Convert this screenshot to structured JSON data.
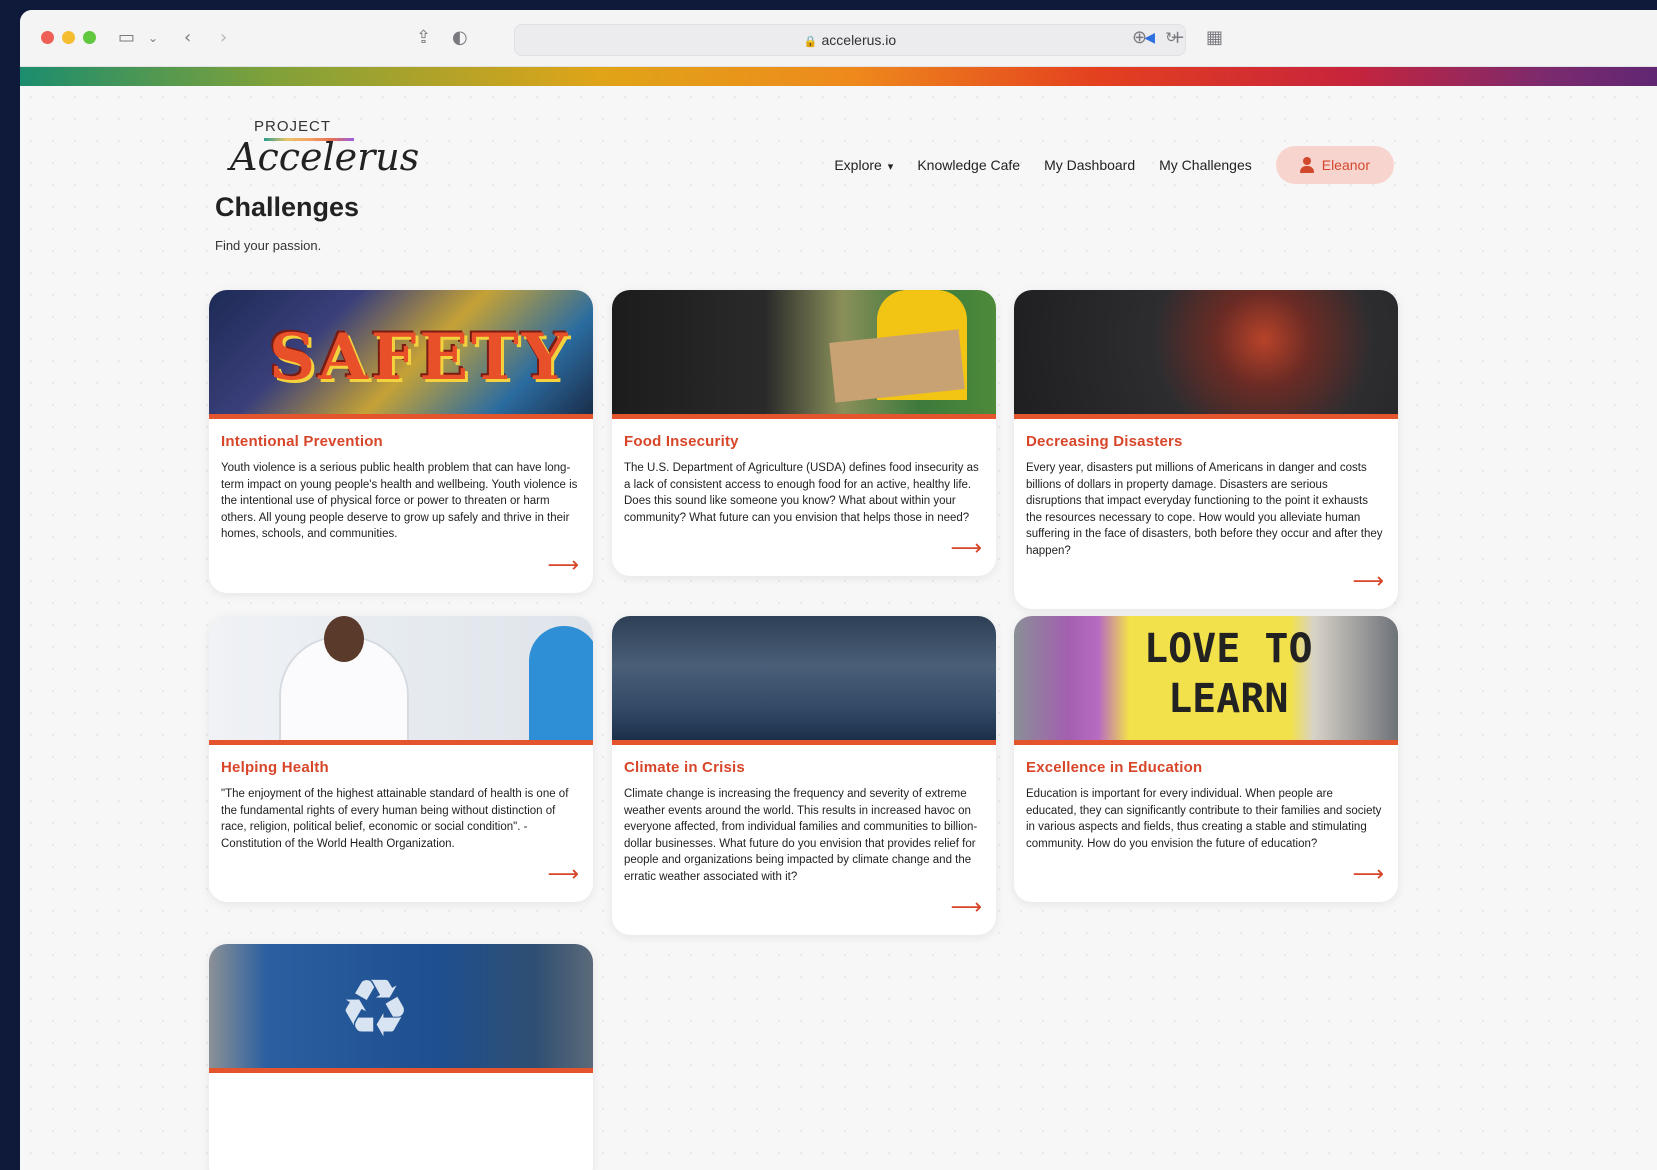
{
  "browser": {
    "url": "accelerus.io"
  },
  "brand": {
    "top": "PROJECT",
    "name": "Accelerus"
  },
  "nav": {
    "items": [
      {
        "label": "Explore"
      },
      {
        "label": "Knowledge Cafe"
      },
      {
        "label": "My Dashboard"
      },
      {
        "label": "My Challenges"
      }
    ],
    "user": "Eleanor"
  },
  "page": {
    "title": "Challenges",
    "subtitle": "Find your passion."
  },
  "cards": [
    {
      "title": "Intentional Prevention",
      "text": "Youth violence is a serious public health problem that can have long-term impact on young people's health and wellbeing. Youth violence is the intentional use of physical force or power to threaten or harm others. All young people deserve to grow up safely and thrive in their homes, schools, and communities.",
      "image_word": "SAFETY"
    },
    {
      "title": "Food Insecurity",
      "text": "The U.S. Department of Agriculture (USDA) defines food insecurity as a lack of consistent access to enough food for an active, healthy life. Does this sound like someone you know? What about within your community? What future can you envision that helps those in need?"
    },
    {
      "title": "Decreasing Disasters",
      "text": "Every year, disasters put millions of Americans in danger and costs billions of dollars in property damage. Disasters are serious disruptions that impact everyday functioning to the point it exhausts the resources necessary to cope. How would you alleviate human suffering in the face of disasters, both before they occur and after they happen?"
    },
    {
      "title": "Helping Health",
      "text": "\"The enjoyment of the highest attainable standard of health is one of the fundamental rights of every human being without distinction of race, religion, political belief, economic or social condition\". - Constitution of the World Health Organization."
    },
    {
      "title": "Climate in Crisis",
      "text": "Climate change is increasing the frequency and severity of extreme weather events around the world. This results in increased havoc on everyone affected, from individual families and communities to billion-dollar businesses. What future do you envision that provides relief for people and organizations being impacted by climate change and the erratic weather associated with it?"
    },
    {
      "title": "Excellence in Education",
      "text": "Education is important for every individual. When people are educated, they can significantly contribute to their families and society in various aspects and fields, thus creating a stable and stimulating community. How do you envision the future of education?",
      "image_word_1": "LOVE TO",
      "image_word_2": "LEARN"
    },
    {
      "title": "",
      "text": ""
    }
  ],
  "icons": {
    "arrow": "arrow-right-icon",
    "user": "user-icon"
  },
  "colors": {
    "accent": "#d8462a",
    "user_bg": "#f8d4ce"
  }
}
